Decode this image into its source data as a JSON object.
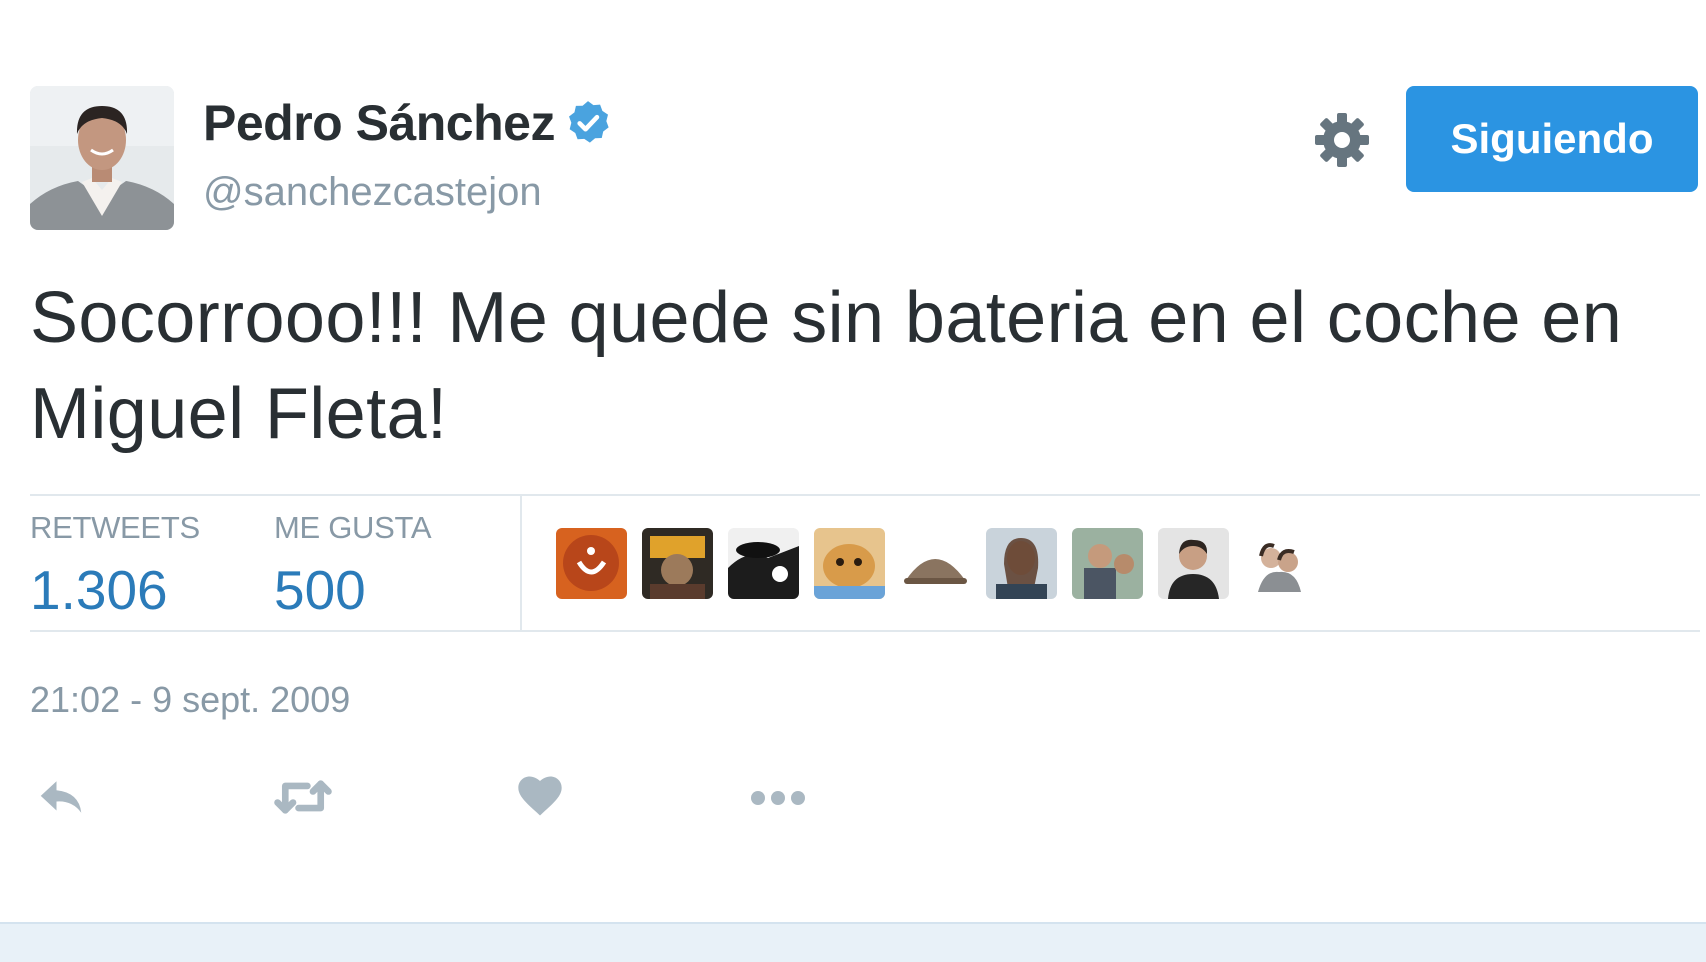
{
  "profile": {
    "display_name": "Pedro Sánchez",
    "handle": "@sanchezcastejon",
    "verified": true
  },
  "header": {
    "follow_label": "Siguiendo",
    "accent_color": "#2b94e2"
  },
  "tweet": {
    "text": "Socorrooo!!! Me quede sin bateria en el coche en Miguel Fleta!",
    "timestamp": "21:02 - 9 sept. 2009"
  },
  "stats": {
    "retweets_label": "RETWEETS",
    "retweets_count": "1.306",
    "likes_label": "ME GUSTA",
    "likes_count": "500",
    "value_color": "#2b7bb9"
  },
  "likers_count_shown": 9,
  "actions": [
    {
      "icon": "reply-icon"
    },
    {
      "icon": "retweet-icon"
    },
    {
      "icon": "heart-icon"
    },
    {
      "icon": "more-icon"
    }
  ]
}
